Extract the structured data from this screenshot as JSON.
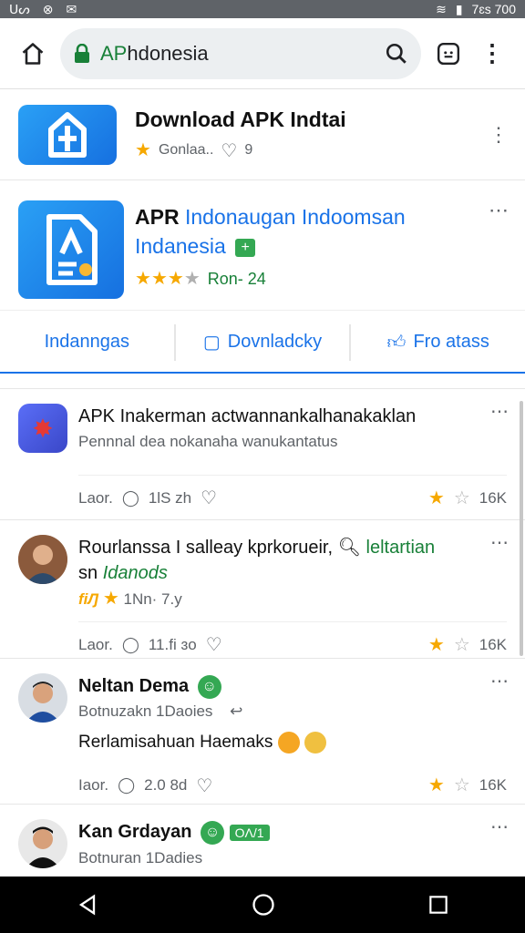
{
  "status_bar": {
    "left_text": "ᑌᔕ",
    "right_text": "7ɛs 700"
  },
  "browser": {
    "url_prefix": "AP",
    "url_rest": "hdonesia"
  },
  "header_card": {
    "title": "Download APK Indtai",
    "meta_text": "Gonlaa..",
    "meta_count": "9"
  },
  "app_card": {
    "name_bold": "APR",
    "name_blue": "Indonaugan Indoomsan Indanesia",
    "rating_text": "Ron- 24",
    "stars": 3,
    "tabs": [
      {
        "label": "Indanngas"
      },
      {
        "label": "Dovnladcky"
      },
      {
        "label": "Fro atass"
      }
    ]
  },
  "posts": [
    {
      "title": "APK Inakerman actwannankalhanakaklan",
      "subtitle": "Pennnal dea nokanaha wanukantatus",
      "action_left": "Laor.",
      "comments": "1lS zh",
      "count": "16K"
    },
    {
      "title": "Rourlanssa I salleay kprkorueir,",
      "title_green": "leltartian",
      "line2": "sn",
      "line2_green": "Idanods",
      "sub_tag": "fiԒ",
      "sub_text": "1Nn· 7.y",
      "action_left": "Laor.",
      "comments": "11.fi ɜo",
      "count": "16K"
    },
    {
      "title": "Neltan Dema",
      "subtitle": "Botnuzakn 1Daoies",
      "body": "Rerlamisahuan Haemaks",
      "action_left": "Iaor.",
      "comments": "2.0 8d",
      "count": "16K"
    },
    {
      "title": "Kan Grdayan",
      "tag": "ОΛ/1",
      "subtitle": "Botnuran 1Dadies"
    }
  ],
  "colors": {
    "accent": "#1a73e8",
    "green": "#188038",
    "star": "#f6a800"
  }
}
